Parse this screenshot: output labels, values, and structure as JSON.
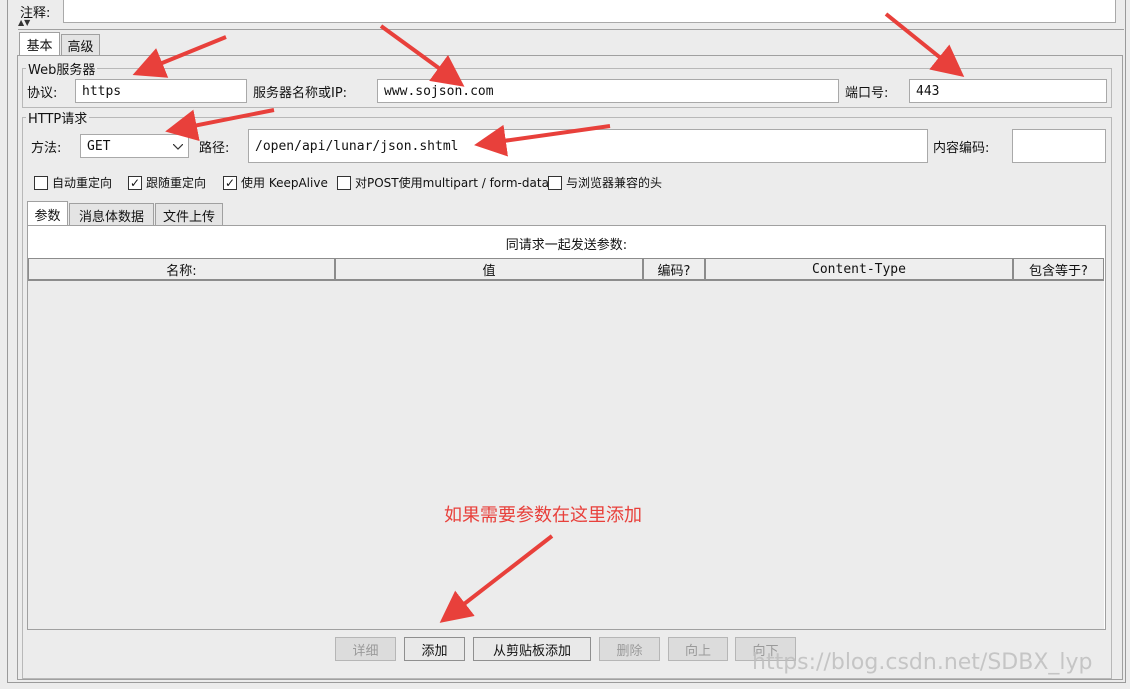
{
  "comment": {
    "label": "注释:",
    "value": ""
  },
  "main_tabs": [
    {
      "label": "基本"
    },
    {
      "label": "高级"
    }
  ],
  "web_server": {
    "title": "Web服务器",
    "protocol_label": "协议:",
    "protocol_value": "https",
    "host_label": "服务器名称或IP:",
    "host_value": "www.sojson.com",
    "port_label": "端口号:",
    "port_value": "443"
  },
  "http_request": {
    "title": "HTTP请求",
    "method_label": "方法:",
    "method_value": "GET",
    "path_label": "路径:",
    "path_value": "/open/api/lunar/json.shtml",
    "encoding_label": "内容编码:",
    "encoding_value": ""
  },
  "checkboxes": [
    {
      "label": "自动重定向",
      "checked": false
    },
    {
      "label": "跟随重定向",
      "checked": true
    },
    {
      "label": "使用 KeepAlive",
      "checked": true
    },
    {
      "label": "对POST使用multipart / form-data",
      "checked": false
    },
    {
      "label": "与浏览器兼容的头",
      "checked": false
    }
  ],
  "param_tabs": [
    {
      "label": "参数"
    },
    {
      "label": "消息体数据"
    },
    {
      "label": "文件上传"
    }
  ],
  "params_caption": "同请求一起发送参数:",
  "columns": [
    "名称:",
    "值",
    "编码?",
    "Content-Type",
    "包含等于?"
  ],
  "annotation": "如果需要参数在这里添加",
  "buttons": [
    {
      "label": "详细",
      "enabled": false
    },
    {
      "label": "添加",
      "enabled": true
    },
    {
      "label": "从剪贴板添加",
      "enabled": true
    },
    {
      "label": "删除",
      "enabled": false
    },
    {
      "label": "向上",
      "enabled": false
    },
    {
      "label": "向下",
      "enabled": false
    }
  ],
  "watermark": "https://blog.csdn.net/SDBX_lyp",
  "colors": {
    "arrow": "#e8403b",
    "annotation": "#e8403b"
  },
  "icons": {
    "checkmark": "check-icon",
    "dropdown": "chevron-down-icon"
  }
}
